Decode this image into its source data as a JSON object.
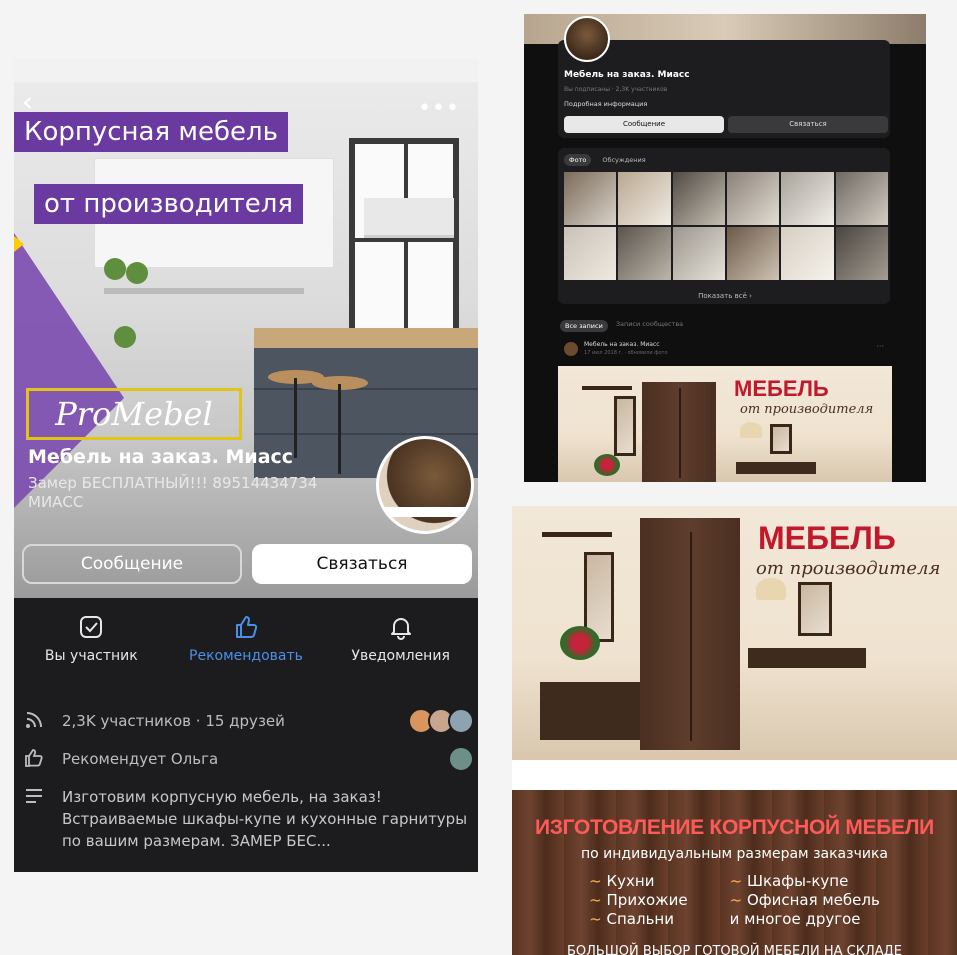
{
  "left": {
    "banner_line1": "Корпусная мебель",
    "banner_line2": "от производителя",
    "brand_logo": "ProMebel",
    "group_name": "Мебель на заказ. Миасс",
    "group_status": "Замер БЕСПЛАТНЫЙ!!! 89514434734 МИАСС",
    "message_button": "Сообщение",
    "contact_button": "Связаться",
    "actions": [
      {
        "label": "Вы участник",
        "icon": "check-square-icon"
      },
      {
        "label": "Рекомендовать",
        "icon": "thumbs-up-icon"
      },
      {
        "label": "Уведомления",
        "icon": "bell-icon"
      }
    ],
    "members_text": "2,3K участников · 15 друзей",
    "recommends_text": "Рекомендует Ольга",
    "description_text": "Изготовим корпусную мебель, на заказ! Встраиваемые шкафы-купе и кухонные гарнитуры по вашим размерам. ЗАМЕР БЕС...",
    "accent_color": "#4a8fe8",
    "banner_color": "#6a3aa0"
  },
  "right_top": {
    "group_name": "Мебель на заказ. Миасс",
    "subscribed_text": "Вы подписаны · 2,3K участников",
    "more_info": "Подробная информация",
    "message_button": "Сообщение",
    "contact_button": "Связаться",
    "photo_tabs": [
      "Фото",
      "Обсуждения"
    ],
    "show_all": "Показать всё ›",
    "feed_tabs": [
      "Все записи",
      "Записи сообщества"
    ],
    "post_author": "Мебель на заказ. Миасс",
    "post_date": "17 июл 2018 г. · обновили фото",
    "ad_title": "МЕБЕЛЬ",
    "ad_subtitle": "от производителя"
  },
  "right_bottom": {
    "ad_title": "МЕБЕЛЬ",
    "ad_subtitle": "от производителя",
    "wood_title": "ИЗГОТОВЛЕНИЕ КОРПУСНОЙ МЕБЕЛИ",
    "wood_subtitle": "по индивидуальным размерам заказчика",
    "col1": [
      "Кухни",
      "Прихожие",
      "Спальни"
    ],
    "col2": [
      "Шкафы-купе",
      "Офисная мебель",
      "и многое другое"
    ],
    "footer": "БОЛЬШОЙ ВЫБОР ГОТОВОЙ МЕБЕЛИ НА СКЛАДЕ"
  }
}
